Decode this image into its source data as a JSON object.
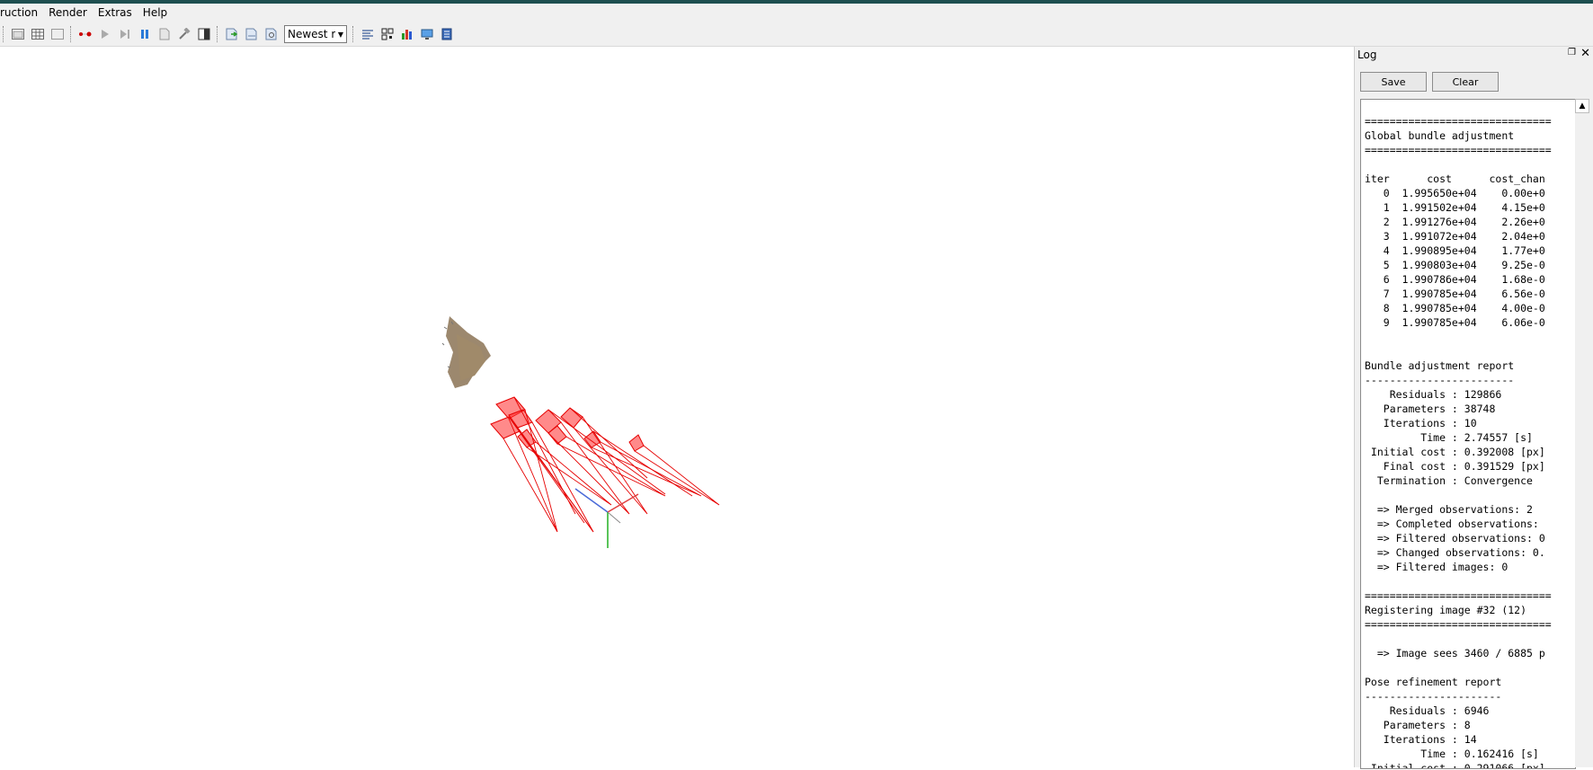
{
  "menu": {
    "items": [
      "ruction",
      "Render",
      "Extras",
      "Help"
    ]
  },
  "toolbar": {
    "icons": [
      "grip",
      "window-icon",
      "grid-icon",
      "window-blank-icon",
      "grip",
      "record-icon",
      "play-icon",
      "step-icon",
      "pause-icon",
      "file-icon",
      "hammer-icon",
      "contrast-icon",
      "grip",
      "export-icon",
      "import-icon",
      "sync-icon"
    ],
    "combo_value": "Newest r",
    "icons_after": [
      "grip",
      "list-icon",
      "qr-icon",
      "bar-chart-icon",
      "monitor-icon",
      "database-icon"
    ]
  },
  "log": {
    "title": "Log",
    "save_label": "Save",
    "clear_label": "Clear",
    "lines": [
      "",
      "==============================",
      "Global bundle adjustment",
      "==============================",
      "",
      "iter      cost      cost_chan",
      "   0  1.995650e+04    0.00e+0",
      "   1  1.991502e+04    4.15e+0",
      "   2  1.991276e+04    2.26e+0",
      "   3  1.991072e+04    2.04e+0",
      "   4  1.990895e+04    1.77e+0",
      "   5  1.990803e+04    9.25e-0",
      "   6  1.990786e+04    1.68e-0",
      "   7  1.990785e+04    6.56e-0",
      "   8  1.990785e+04    4.00e-0",
      "   9  1.990785e+04    6.06e-0",
      "",
      "",
      "Bundle adjustment report",
      "------------------------",
      "    Residuals : 129866",
      "   Parameters : 38748",
      "   Iterations : 10",
      "         Time : 2.74557 [s]",
      " Initial cost : 0.392008 [px]",
      "   Final cost : 0.391529 [px]",
      "  Termination : Convergence",
      "",
      "  => Merged observations: 2",
      "  => Completed observations:",
      "  => Filtered observations: 0",
      "  => Changed observations: 0.",
      "  => Filtered images: 0",
      "",
      "==============================",
      "Registering image #32 (12)",
      "==============================",
      "",
      "  => Image sees 3460 / 6885 p",
      "",
      "Pose refinement report",
      "----------------------",
      "    Residuals : 6946",
      "   Parameters : 8",
      "   Iterations : 14",
      "         Time : 0.162416 [s]",
      " Initial cost : 0.291066 [px]"
    ]
  },
  "viewport": {
    "camera_color": "#ff0000",
    "pointcloud_color": "#8b7355"
  }
}
